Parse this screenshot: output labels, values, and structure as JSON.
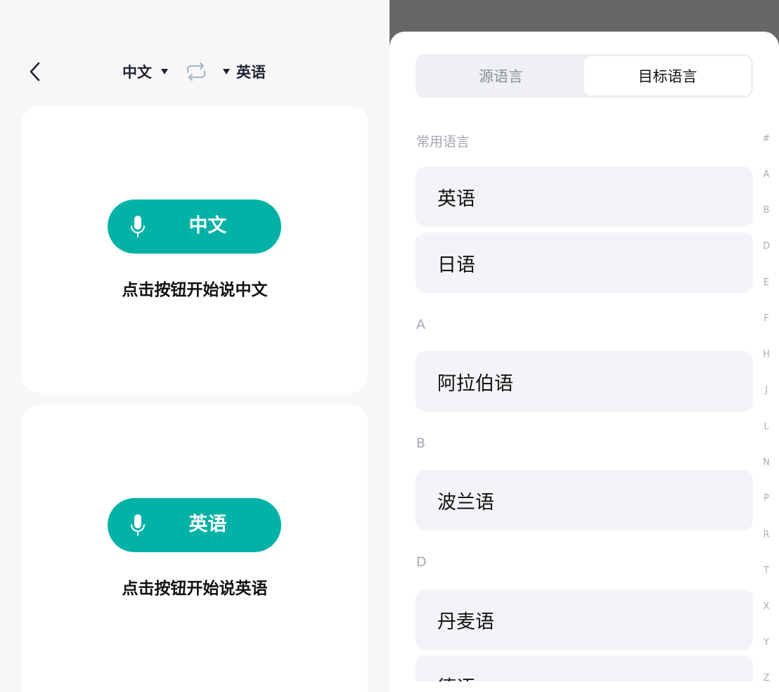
{
  "nav": {
    "source_lang": "中文",
    "target_lang": "英语"
  },
  "cards": [
    {
      "button_label": "中文",
      "hint": "点击按钮开始说中文"
    },
    {
      "button_label": "英语",
      "hint": "点击按钮开始说英语"
    }
  ],
  "picker": {
    "tabs": [
      "源语言",
      "目标语言"
    ],
    "active_tab": "目标语言",
    "sections": [
      {
        "title": "常用语言",
        "items": [
          "英语",
          "日语"
        ]
      },
      {
        "title": "A",
        "items": [
          "阿拉伯语"
        ]
      },
      {
        "title": "B",
        "items": [
          "波兰语"
        ]
      },
      {
        "title": "D",
        "items": [
          "丹麦语",
          "德语"
        ]
      }
    ],
    "index": [
      "#",
      "A",
      "B",
      "D",
      "E",
      "F",
      "H",
      "J",
      "L",
      "N",
      "P",
      "R",
      "T",
      "X",
      "Y",
      "Z"
    ]
  },
  "colors": {
    "accent": "#02b2a7",
    "overlay": "#676767",
    "item_bg": "#f2f4f7"
  },
  "icons": {
    "back": "chevron-left-icon",
    "swap": "swap-icon",
    "mic": "microphone-icon",
    "caret": "caret-down-icon"
  }
}
